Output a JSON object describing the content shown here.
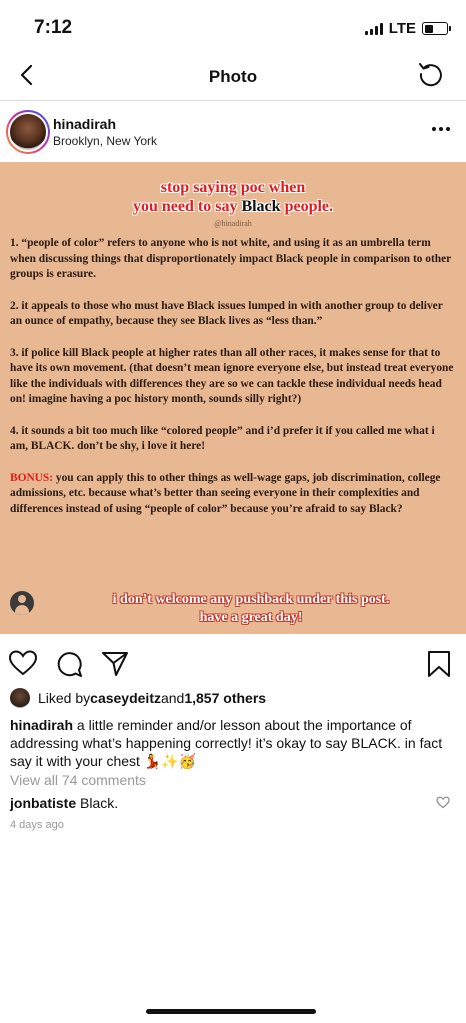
{
  "status": {
    "time": "7:12",
    "network": "LTE",
    "battery_level": 0.45
  },
  "nav": {
    "title": "Photo",
    "back_icon": "chevron-left-icon",
    "refresh_icon": "refresh-icon"
  },
  "post": {
    "username": "hinadirah",
    "location": "Brooklyn, New York",
    "image": {
      "title_line1": "stop saying poc when",
      "title_line2_pre": "you need to say",
      "title_line2_black": "Black",
      "title_line2_post": "people.",
      "handle": "@hinadirah",
      "point1": "1. “people of color” refers to anyone who is not white, and using it as an umbrella term when discussing things that disproportionately impact Black people in comparison to other groups is erasure.",
      "point2": "2. it appeals to those who must have Black issues lumped in with another group to deliver an ounce of empathy, because they see Black lives as “less than.”",
      "point3": "3. if police kill Black people at higher rates than all other races, it makes sense for that to have its own movement. (that doesn’t mean ignore everyone else, but instead treat everyone like the individuals with differences they are so we can tackle these individual needs head on! imagine having a poc history month, sounds silly right?)",
      "point4": "4. it sounds a bit too much like “colored people” and i’d prefer it if you called me what i am, BLACK. don’t be shy, i love it here!",
      "bonus_label": "BONUS:",
      "bonus_text": " you can apply this to other things as well-wage gaps, job discrimination, college admissions, etc. because what’s better than seeing everyone in their complexities and differences instead of using “people of color” because you’re afraid to say Black?",
      "closing_line1": "i don’t welcome any pushback under this post.",
      "closing_line2": "have a great day!",
      "background_color": "#e8b893",
      "accent_color": "#e21c1c"
    },
    "likes": {
      "prefix": "Liked by ",
      "user": "caseydeitz",
      "middle": " and ",
      "count": "1,857 others"
    },
    "caption": {
      "user": "hinadirah",
      "text": " a little reminder and/or lesson about the importance of addressing what’s happening correctly! it’s okay to say BLACK. in fact say it with your chest 💃✨🥳"
    },
    "view_comments": "View all 74 comments",
    "comment": {
      "user": "jonbatiste",
      "text": " Black."
    },
    "timestamp": "4 days ago"
  }
}
